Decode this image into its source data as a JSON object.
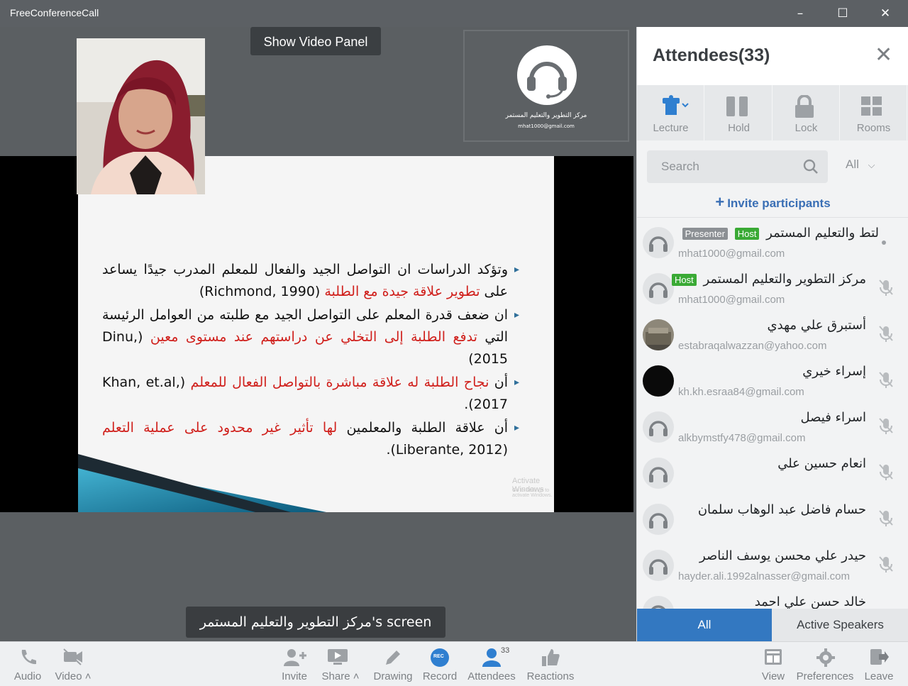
{
  "window": {
    "title": "FreeConferenceCall",
    "minimize": "–",
    "maximize": "☐",
    "close": "✕"
  },
  "stage": {
    "show_video_panel": "Show Video Panel",
    "tile": {
      "name": "مركز التطوير والتعليم المستمر",
      "email": "mhat1000@gmail.com"
    },
    "screen_label": "مركز التطوير والتعليم المستمر's screen",
    "slide": {
      "bullets": [
        {
          "plain": "وتؤكد الدراسات ان التواصل الجيد والفعال للمعلم المدرب جيدًا يساعد على ",
          "red": "تطوير علاقة جيدة مع الطلبة",
          "tail": " (Richmond, 1990)"
        },
        {
          "plain": "ان ضعف قدرة المعلم على التواصل الجيد مع طلبته من العوامل الرئيسة التي ",
          "red": "تدفع الطلبة إلى التخلي عن دراستهم عند مستوى معين",
          "tail": " (Dinu, 2015)"
        },
        {
          "plain": "أن ",
          "red": "نجاح الطلبة له علاقة مباشرة بالتواصل الفعال للمعلم",
          "tail": " (Khan, et.al, 2017)."
        },
        {
          "plain": "أن علاقة الطلبة والمعلمين ",
          "red": "لها تأثير غير محدود على عملية التعلم",
          "tail": " (Liberante, 2012)."
        }
      ],
      "watermark": "Activate Windows",
      "watermark_sub": "Go to Settings to activate Windows."
    }
  },
  "panel": {
    "title": "Attendees(33)",
    "close": "✕",
    "tools": [
      "Lecture",
      "Hold",
      "Lock",
      "Rooms"
    ],
    "search_placeholder": "Search",
    "filter": "All",
    "invite": "Invite participants",
    "attendees": [
      {
        "name": "لتط والتعليم المستمر",
        "email": "mhat1000@gmail.com",
        "badges": [
          "Host",
          "Presenter"
        ],
        "avatar": "headset"
      },
      {
        "name": "مركز التطوير والتعليم المستمر",
        "email": "mhat1000@gmail.com",
        "badges": [
          "Host"
        ],
        "avatar": "headset"
      },
      {
        "name": "أستبرق علي مهدي",
        "email": "estabraqalwazzan@yahoo.com",
        "badges": [],
        "avatar": "photo"
      },
      {
        "name": "إسراء خيري",
        "email": "kh.kh.esraa84@gmail.com",
        "badges": [],
        "avatar": "dark"
      },
      {
        "name": "اسراء فيصل",
        "email": "alkbymstfy478@gmail.com",
        "badges": [],
        "avatar": "headset"
      },
      {
        "name": "انعام حسين علي",
        "email": "",
        "badges": [],
        "avatar": "headset"
      },
      {
        "name": "حسام فاضل عبد الوهاب سلمان",
        "email": "",
        "badges": [],
        "avatar": "headset"
      },
      {
        "name": "حيدر علي محسن يوسف الناصر",
        "email": "hayder.ali.1992alnasser@gmail.com",
        "badges": [],
        "avatar": "headset"
      },
      {
        "name": "خالد حسن علي احمد",
        "email": "",
        "badges": [],
        "avatar": "headset"
      }
    ],
    "tabs": {
      "all": "All",
      "active": "Active Speakers"
    }
  },
  "toolbar": {
    "audio": "Audio",
    "video": "Video",
    "invite": "Invite",
    "share": "Share",
    "drawing": "Drawing",
    "record": "Record",
    "record_badge": "REC",
    "attendees": "Attendees",
    "attendees_count": "33",
    "reactions": "Reactions",
    "view": "View",
    "preferences": "Preferences",
    "leave": "Leave"
  },
  "colors": {
    "accent": "#3378c1",
    "host": "#3aaa35",
    "presenter": "#8c9094",
    "record": "#2f7fd0"
  }
}
